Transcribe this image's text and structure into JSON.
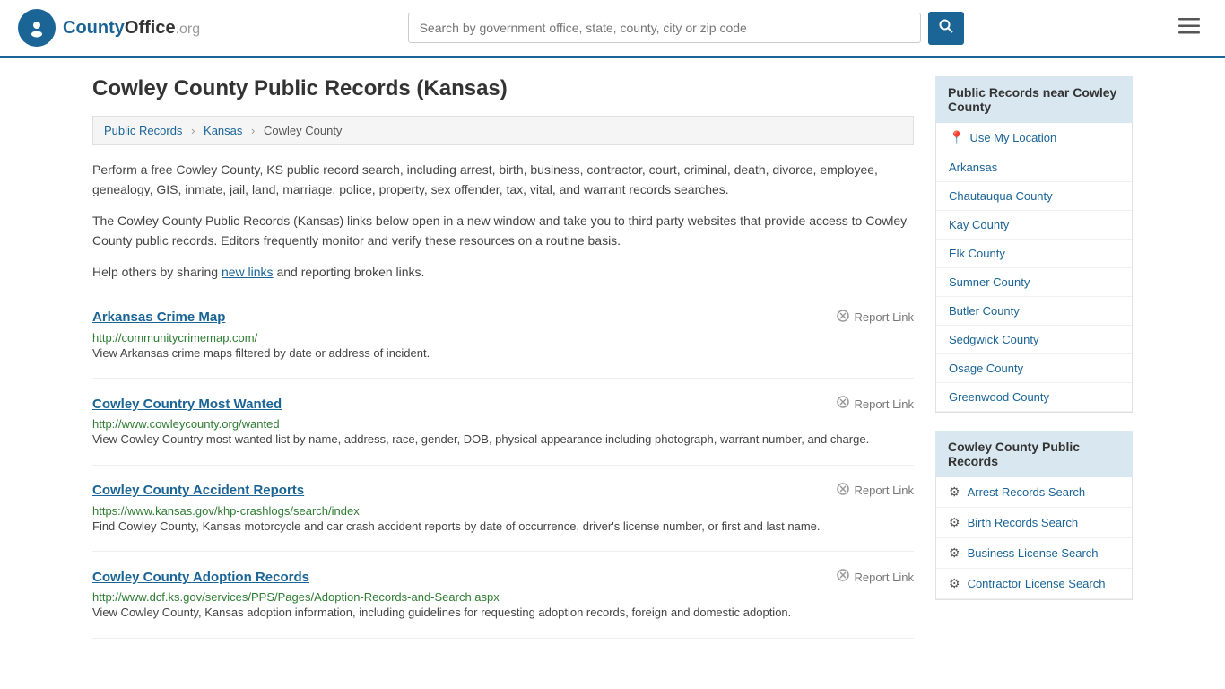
{
  "header": {
    "logo_text": "County",
    "logo_org": "Office",
    "logo_domain": ".org",
    "search_placeholder": "Search by government office, state, county, city or zip code",
    "search_value": ""
  },
  "page": {
    "title": "Cowley County Public Records (Kansas)",
    "breadcrumb": {
      "items": [
        "Public Records",
        "Kansas",
        "Cowley County"
      ]
    },
    "description1": "Perform a free Cowley County, KS public record search, including arrest, birth, business, contractor, court, criminal, death, divorce, employee, genealogy, GIS, inmate, jail, land, marriage, police, property, sex offender, tax, vital, and warrant records searches.",
    "description2": "The Cowley County Public Records (Kansas) links below open in a new window and take you to third party websites that provide access to Cowley County public records. Editors frequently monitor and verify these resources on a routine basis.",
    "description3": "Help others by sharing",
    "new_links_text": "new links",
    "description3b": "and reporting broken links."
  },
  "records": [
    {
      "title": "Arkansas Crime Map",
      "url": "http://communitycrimemap.com/",
      "description": "View Arkansas crime maps filtered by date or address of incident.",
      "report_label": "Report Link"
    },
    {
      "title": "Cowley Country Most Wanted",
      "url": "http://www.cowleycounty.org/wanted",
      "description": "View Cowley Country most wanted list by name, address, race, gender, DOB, physical appearance including photograph, warrant number, and charge.",
      "report_label": "Report Link"
    },
    {
      "title": "Cowley County Accident Reports",
      "url": "https://www.kansas.gov/khp-crashlogs/search/index",
      "description": "Find Cowley County, Kansas motorcycle and car crash accident reports by date of occurrence, driver's license number, or first and last name.",
      "report_label": "Report Link"
    },
    {
      "title": "Cowley County Adoption Records",
      "url": "http://www.dcf.ks.gov/services/PPS/Pages/Adoption-Records-and-Search.aspx",
      "description": "View Cowley County, Kansas adoption information, including guidelines for requesting adoption records, foreign and domestic adoption.",
      "report_label": "Report Link"
    }
  ],
  "sidebar": {
    "nearby_header": "Public Records near Cowley County",
    "use_location_label": "Use My Location",
    "nearby_links": [
      "Arkansas",
      "Chautauqua County",
      "Kay County",
      "Elk County",
      "Sumner County",
      "Butler County",
      "Sedgwick County",
      "Osage County",
      "Greenwood County"
    ],
    "records_header": "Cowley County Public Records",
    "records_links": [
      {
        "label": "Arrest Records Search",
        "icon": "■"
      },
      {
        "label": "Birth Records Search",
        "icon": "👤"
      },
      {
        "label": "Business License Search",
        "icon": "⚙"
      },
      {
        "label": "Contractor License Search",
        "icon": "⚙"
      }
    ]
  }
}
